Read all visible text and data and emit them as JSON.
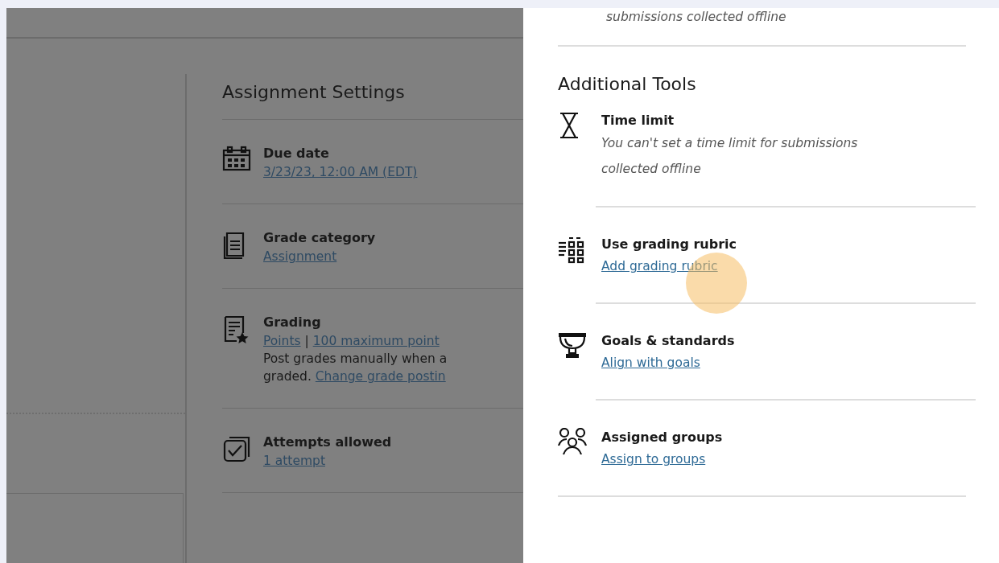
{
  "settings": {
    "title": "Assignment Settings",
    "items": [
      {
        "kind": "calendar",
        "label": "Due date",
        "lines": [
          [
            {
              "text": "3/23/23, 12:00 AM (EDT)",
              "link": true
            }
          ]
        ]
      },
      {
        "kind": "document",
        "label": "Grade category",
        "lines": [
          [
            {
              "text": "Assignment",
              "link": true
            }
          ]
        ]
      },
      {
        "kind": "grading",
        "label": "Grading",
        "lines": [
          [
            {
              "text": "Points",
              "link": true
            },
            {
              "text": "|",
              "link": false
            },
            {
              "text": "100 maximum point",
              "link": true
            }
          ],
          [
            {
              "text": "Post grades manually when a",
              "link": false
            }
          ],
          [
            {
              "text": "graded.",
              "link": false
            },
            {
              "text": "Change grade postin",
              "link": true
            }
          ]
        ]
      },
      {
        "kind": "attempts",
        "label": "Attempts allowed",
        "lines": [
          [
            {
              "text": "1 attempt",
              "link": true
            }
          ]
        ]
      }
    ]
  },
  "panel": {
    "top_note": "submissions collected offline",
    "title": "Additional Tools",
    "tools": [
      {
        "kind": "hourglass",
        "label": "Time limit",
        "note": "You can't set a time limit for submissions collected offline"
      },
      {
        "kind": "rubric",
        "label": "Use grading rubric",
        "link": "Add grading rubric",
        "clicked": true
      },
      {
        "kind": "trophy",
        "label": "Goals & standards",
        "link": "Align with goals",
        "clicked": false
      },
      {
        "kind": "groups",
        "label": "Assigned groups",
        "link": "Assign to groups",
        "clicked": false
      }
    ]
  }
}
